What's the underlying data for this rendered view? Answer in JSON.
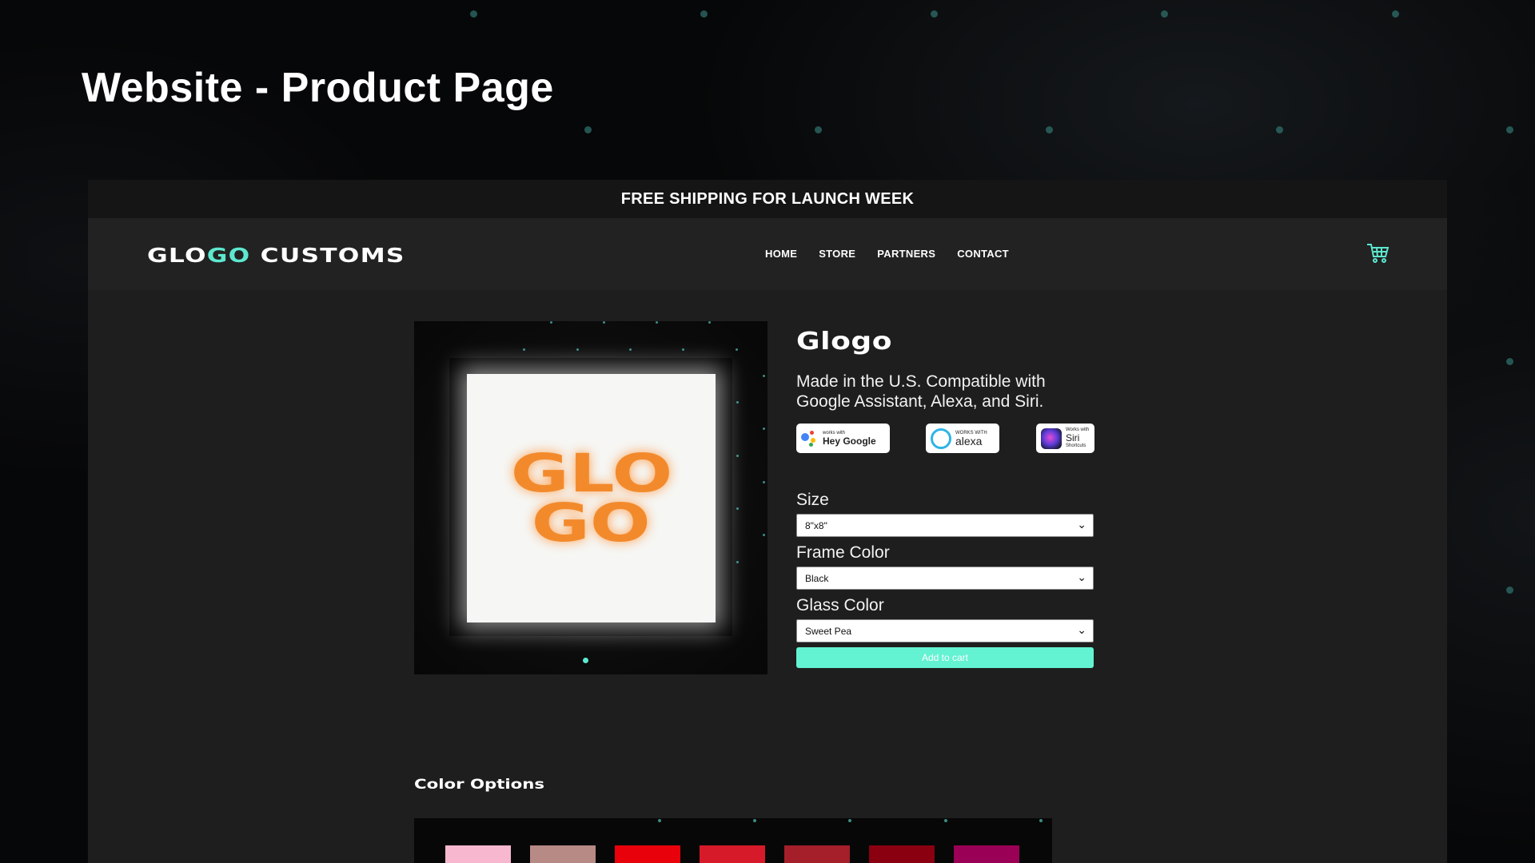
{
  "slide": {
    "title": "Website - Product Page"
  },
  "promo": {
    "text": "FREE SHIPPING FOR LAUNCH WEEK"
  },
  "header": {
    "logo_left": "GLO",
    "logo_accent": "GO",
    "logo_right": "CUSTOMS",
    "nav": [
      "HOME",
      "STORE",
      "PARTNERS",
      "CONTACT"
    ],
    "cart_icon": "shopping-cart-icon"
  },
  "product": {
    "image_text_line1": "GLO",
    "image_text_line2": "GO",
    "name": "Glogo",
    "description": "Made in the U.S. Compatible with Google Assistant, Alexa, and Siri.",
    "badges": {
      "google": {
        "small": "works with",
        "big": "Hey Google"
      },
      "alexa": {
        "small": "WORKS WITH",
        "big": "alexa"
      },
      "siri": {
        "small": "Works with",
        "big": "Siri",
        "tiny": "Shortcuts"
      }
    },
    "size": {
      "label": "Size",
      "value": "8\"x8\""
    },
    "frame_color": {
      "label": "Frame Color",
      "value": "Black"
    },
    "glass_color": {
      "label": "Glass Color",
      "value": "Sweet Pea"
    },
    "add_to_cart": "Add to cart"
  },
  "color_options": {
    "title": "Color Options",
    "swatches": [
      "#f7b8cf",
      "#b88a86",
      "#e8000a",
      "#d71a2a",
      "#a51f2a",
      "#8a0010",
      "#9a0055"
    ]
  },
  "colors": {
    "accent": "#5de8cf",
    "button": "#63f2d2",
    "glow_orange": "#f28a2c"
  }
}
